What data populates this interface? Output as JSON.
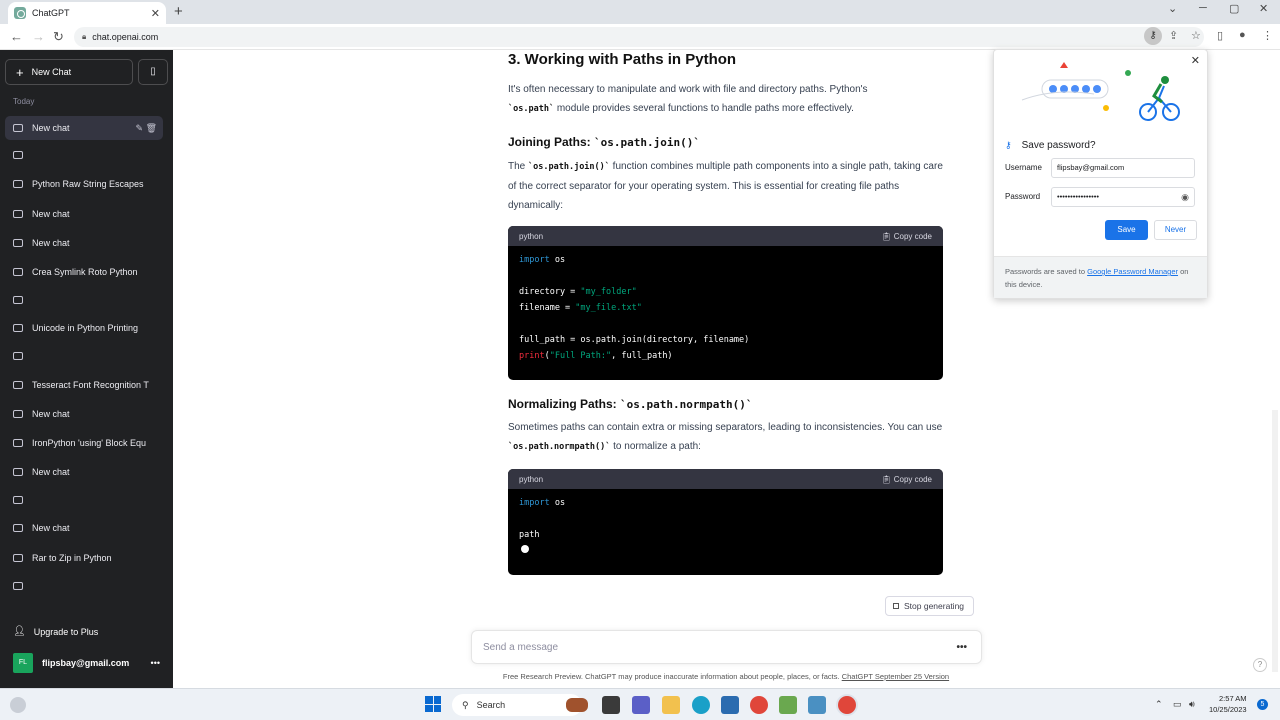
{
  "browser": {
    "tab_title": "ChatGPT",
    "tab_close": "✕",
    "new_tab": "+",
    "url": "chat.openai.com",
    "win_min": "─",
    "win_max": "▢",
    "win_close": "✕",
    "win_list": "⌄"
  },
  "sidebar": {
    "new_chat_label": "New Chat",
    "section_today": "Today",
    "items": [
      {
        "label": "New chat"
      },
      {
        "label": ""
      },
      {
        "label": "Python Raw String Escapes"
      },
      {
        "label": "New chat"
      },
      {
        "label": "New chat"
      },
      {
        "label": "Crea Symlink Roto Python"
      },
      {
        "label": ""
      },
      {
        "label": "Unicode in Python Printing"
      },
      {
        "label": ""
      },
      {
        "label": "Tesseract Font Recognition T"
      },
      {
        "label": "New chat"
      },
      {
        "label": "IronPython 'using' Block Equ"
      },
      {
        "label": "New chat"
      },
      {
        "label": ""
      },
      {
        "label": "New chat"
      },
      {
        "label": "Rar to Zip in Python"
      },
      {
        "label": ""
      }
    ],
    "upgrade_label": "Upgrade to Plus",
    "user_initials": "FL",
    "user_email": "flipsbay@gmail.com"
  },
  "article": {
    "heading": "3. Working with Paths in Python",
    "intro_1": "It's often necessary to manipulate and work with file and directory paths. Python's",
    "intro_code": "`os.path`",
    "intro_2": " module provides several functions to handle paths more effectively.",
    "join_heading_text": "Joining Paths: ",
    "join_heading_code": "`os.path.join()`",
    "join_p_1": "The ",
    "join_p_code": "`os.path.join()`",
    "join_p_2": " function combines multiple path components into a single path, taking care of the correct separator for your operating system. This is essential for creating file paths dynamically:",
    "code1": {
      "lang": "python",
      "copy": "Copy code",
      "l1_kw": "import",
      "l1_rest": " os",
      "l3_a": "directory = ",
      "l3_str": "\"my_folder\"",
      "l4_a": "filename = ",
      "l4_str": "\"my_file.txt\"",
      "l6": "full_path = os.path.join(directory, filename)",
      "l7_fn": "print",
      "l7_b": "(",
      "l7_str": "\"Full Path:\"",
      "l7_c": ", full_path)"
    },
    "norm_heading_text": "Normalizing Paths: ",
    "norm_heading_code": "`os.path.normpath()`",
    "norm_p_1": "Sometimes paths can contain extra or missing separators, leading to inconsistencies. You can use ",
    "norm_p_code": "`os.path.normpath()`",
    "norm_p_2": " to normalize a path:",
    "code2": {
      "lang": "python",
      "copy": "Copy code",
      "l1_kw": "import",
      "l1_rest": " os",
      "l3": "path"
    }
  },
  "composer": {
    "stop_label": "Stop generating",
    "placeholder": "Send a message",
    "more": "•••",
    "footer_text": "Free Research Preview. ChatGPT may produce inaccurate information about people, places, or facts. ",
    "footer_link": "ChatGPT September 25 Version"
  },
  "password_popup": {
    "title": "Save password?",
    "username_label": "Username",
    "username_value": "flipsbay@gmail.com",
    "password_label": "Password",
    "password_value": "••••••••••••••••",
    "save_label": "Save",
    "never_label": "Never",
    "footer_text_1": "Passwords are saved to ",
    "footer_link": "Google Password Manager",
    "footer_text_2": " on this device."
  },
  "taskbar": {
    "search_label": "Search",
    "time": "2:57 AM",
    "date": "10/25/2023",
    "notification_count": "5"
  },
  "colors": {
    "sidebar_bg": "#202123",
    "accent_blue": "#1a73e8",
    "code_bg": "#000000"
  }
}
